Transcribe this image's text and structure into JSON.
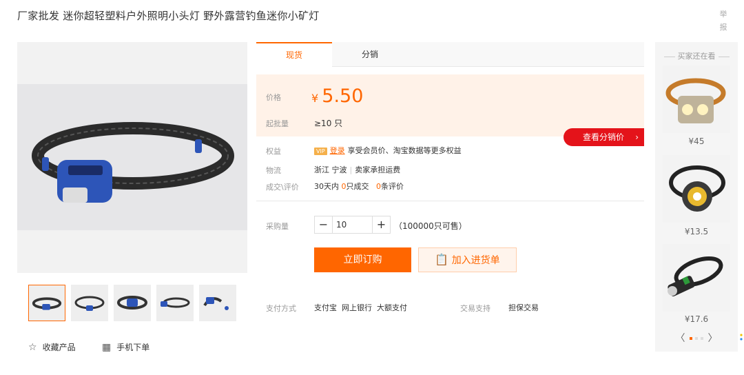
{
  "title": "厂家批发 迷你超轻塑料户外照明小头灯 野外露营钓鱼迷你小矿灯",
  "report": "举报",
  "tabs": [
    "现货",
    "分销"
  ],
  "price": {
    "label": "价格",
    "currency": "¥",
    "value": "5.50"
  },
  "moq": {
    "label": "起批量",
    "value": "≥10 只"
  },
  "distribution_button": "查看分销价",
  "rights": {
    "label": "权益",
    "vip": "VIP",
    "login": "登录",
    "text": "享受会员价、淘宝数据等更多权益"
  },
  "logistics": {
    "label": "物流",
    "origin": "浙江 宁波",
    "shipping": "卖家承担运费"
  },
  "deals": {
    "label": "成交\\评价",
    "prefix": "30天内",
    "count": "0",
    "count_suffix": "只成交",
    "reviews": "0",
    "reviews_suffix": "条评价"
  },
  "purchase": {
    "label": "采购量",
    "minus": "−",
    "plus": "+",
    "quantity": "10",
    "available": "（100000只可售）"
  },
  "buttons": {
    "order": "立即订购",
    "cart": "加入进货单"
  },
  "payment": {
    "label": "支付方式",
    "methods": "支付宝  网上银行  大额支付",
    "support_label": "交易支持",
    "support": "担保交易"
  },
  "actions": {
    "collect": "收藏产品",
    "mobile": "手机下单"
  },
  "sidebar": {
    "title": "买家还在看",
    "items": [
      {
        "price": "¥45"
      },
      {
        "price": "¥13.5"
      },
      {
        "price": "¥17.6"
      }
    ],
    "prev": "〈",
    "next": "〉"
  },
  "colors": {
    "accent": "#ff6600",
    "red": "#e4131a",
    "price_bg": "#fff2e8"
  }
}
